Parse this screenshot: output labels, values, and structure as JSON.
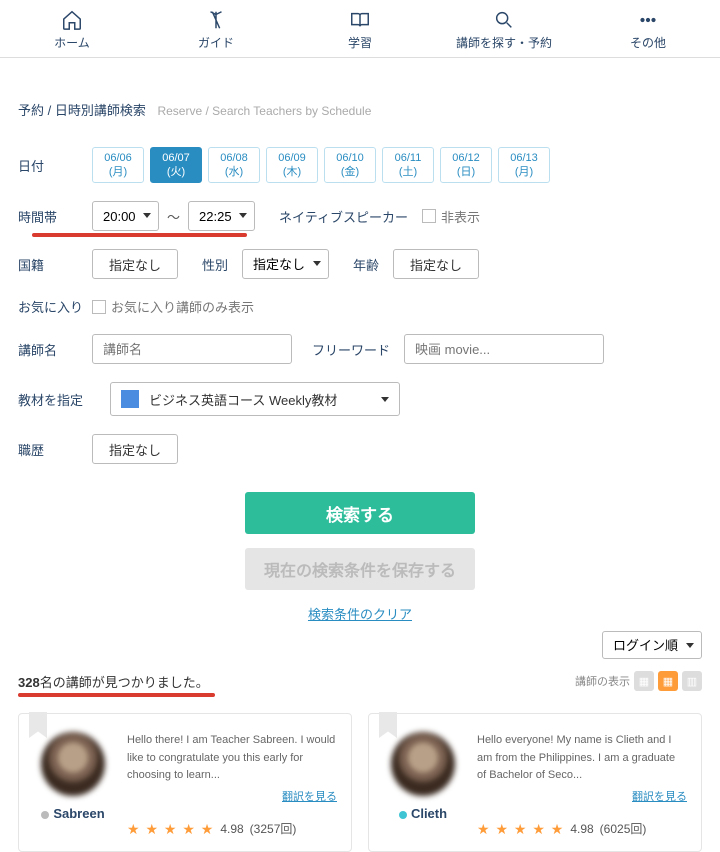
{
  "nav": [
    {
      "label": "ホーム",
      "icon": "home"
    },
    {
      "label": "ガイド",
      "icon": "guide"
    },
    {
      "label": "学習",
      "icon": "study"
    },
    {
      "label": "講師を探す・予約",
      "icon": "search"
    },
    {
      "label": "その他",
      "icon": "more"
    }
  ],
  "breadcrumb": {
    "main": "予約 / 日時別講師検索",
    "sub": "Reserve / Search Teachers by Schedule"
  },
  "labels": {
    "date": "日付",
    "time": "時間帯",
    "native": "ネイティブスピーカー",
    "hide": "非表示",
    "nationality": "国籍",
    "gender": "性別",
    "age": "年齢",
    "none": "指定なし",
    "favorite": "お気に入り",
    "favoriteOnly": "お気に入り講師のみ表示",
    "teacherName": "講師名",
    "freeWord": "フリーワード",
    "material": "教材を指定",
    "workHistory": "職歴"
  },
  "dates": [
    {
      "d": "06/06",
      "w": "(月)"
    },
    {
      "d": "06/07",
      "w": "(火)"
    },
    {
      "d": "06/08",
      "w": "(水)"
    },
    {
      "d": "06/09",
      "w": "(木)"
    },
    {
      "d": "06/10",
      "w": "(金)"
    },
    {
      "d": "06/11",
      "w": "(土)"
    },
    {
      "d": "06/12",
      "w": "(日)"
    },
    {
      "d": "06/13",
      "w": "(月)"
    }
  ],
  "activeDateIdx": 1,
  "time": {
    "from": "20:00",
    "to": "22:25"
  },
  "placeholders": {
    "teacherName": "講師名",
    "freeWord": "映画 movie..."
  },
  "material": "ビジネス英語コース Weekly教材",
  "buttons": {
    "search": "検索する",
    "save": "現在の検索条件を保存する",
    "clear": "検索条件のクリア"
  },
  "sort": "ログイン順",
  "result": {
    "count": "328",
    "suffix": "名の講師が見つかりました。",
    "viewLabel": "講師の表示"
  },
  "transLink": "翻訳を見る",
  "teachers": [
    {
      "name": "Sabreen",
      "status": "gray",
      "intro": "Hello there! I am Teacher Sabreen. I would like to congratulate you this early for choosing to learn...",
      "rating": "4.98",
      "reviews": "(3257回)"
    },
    {
      "name": "Clieth",
      "status": "cyan",
      "intro": "Hello everyone! My name is Clieth and I am from the Philippines. I am a graduate of Bachelor of Seco...",
      "rating": "4.98",
      "reviews": "(6025回)"
    }
  ]
}
